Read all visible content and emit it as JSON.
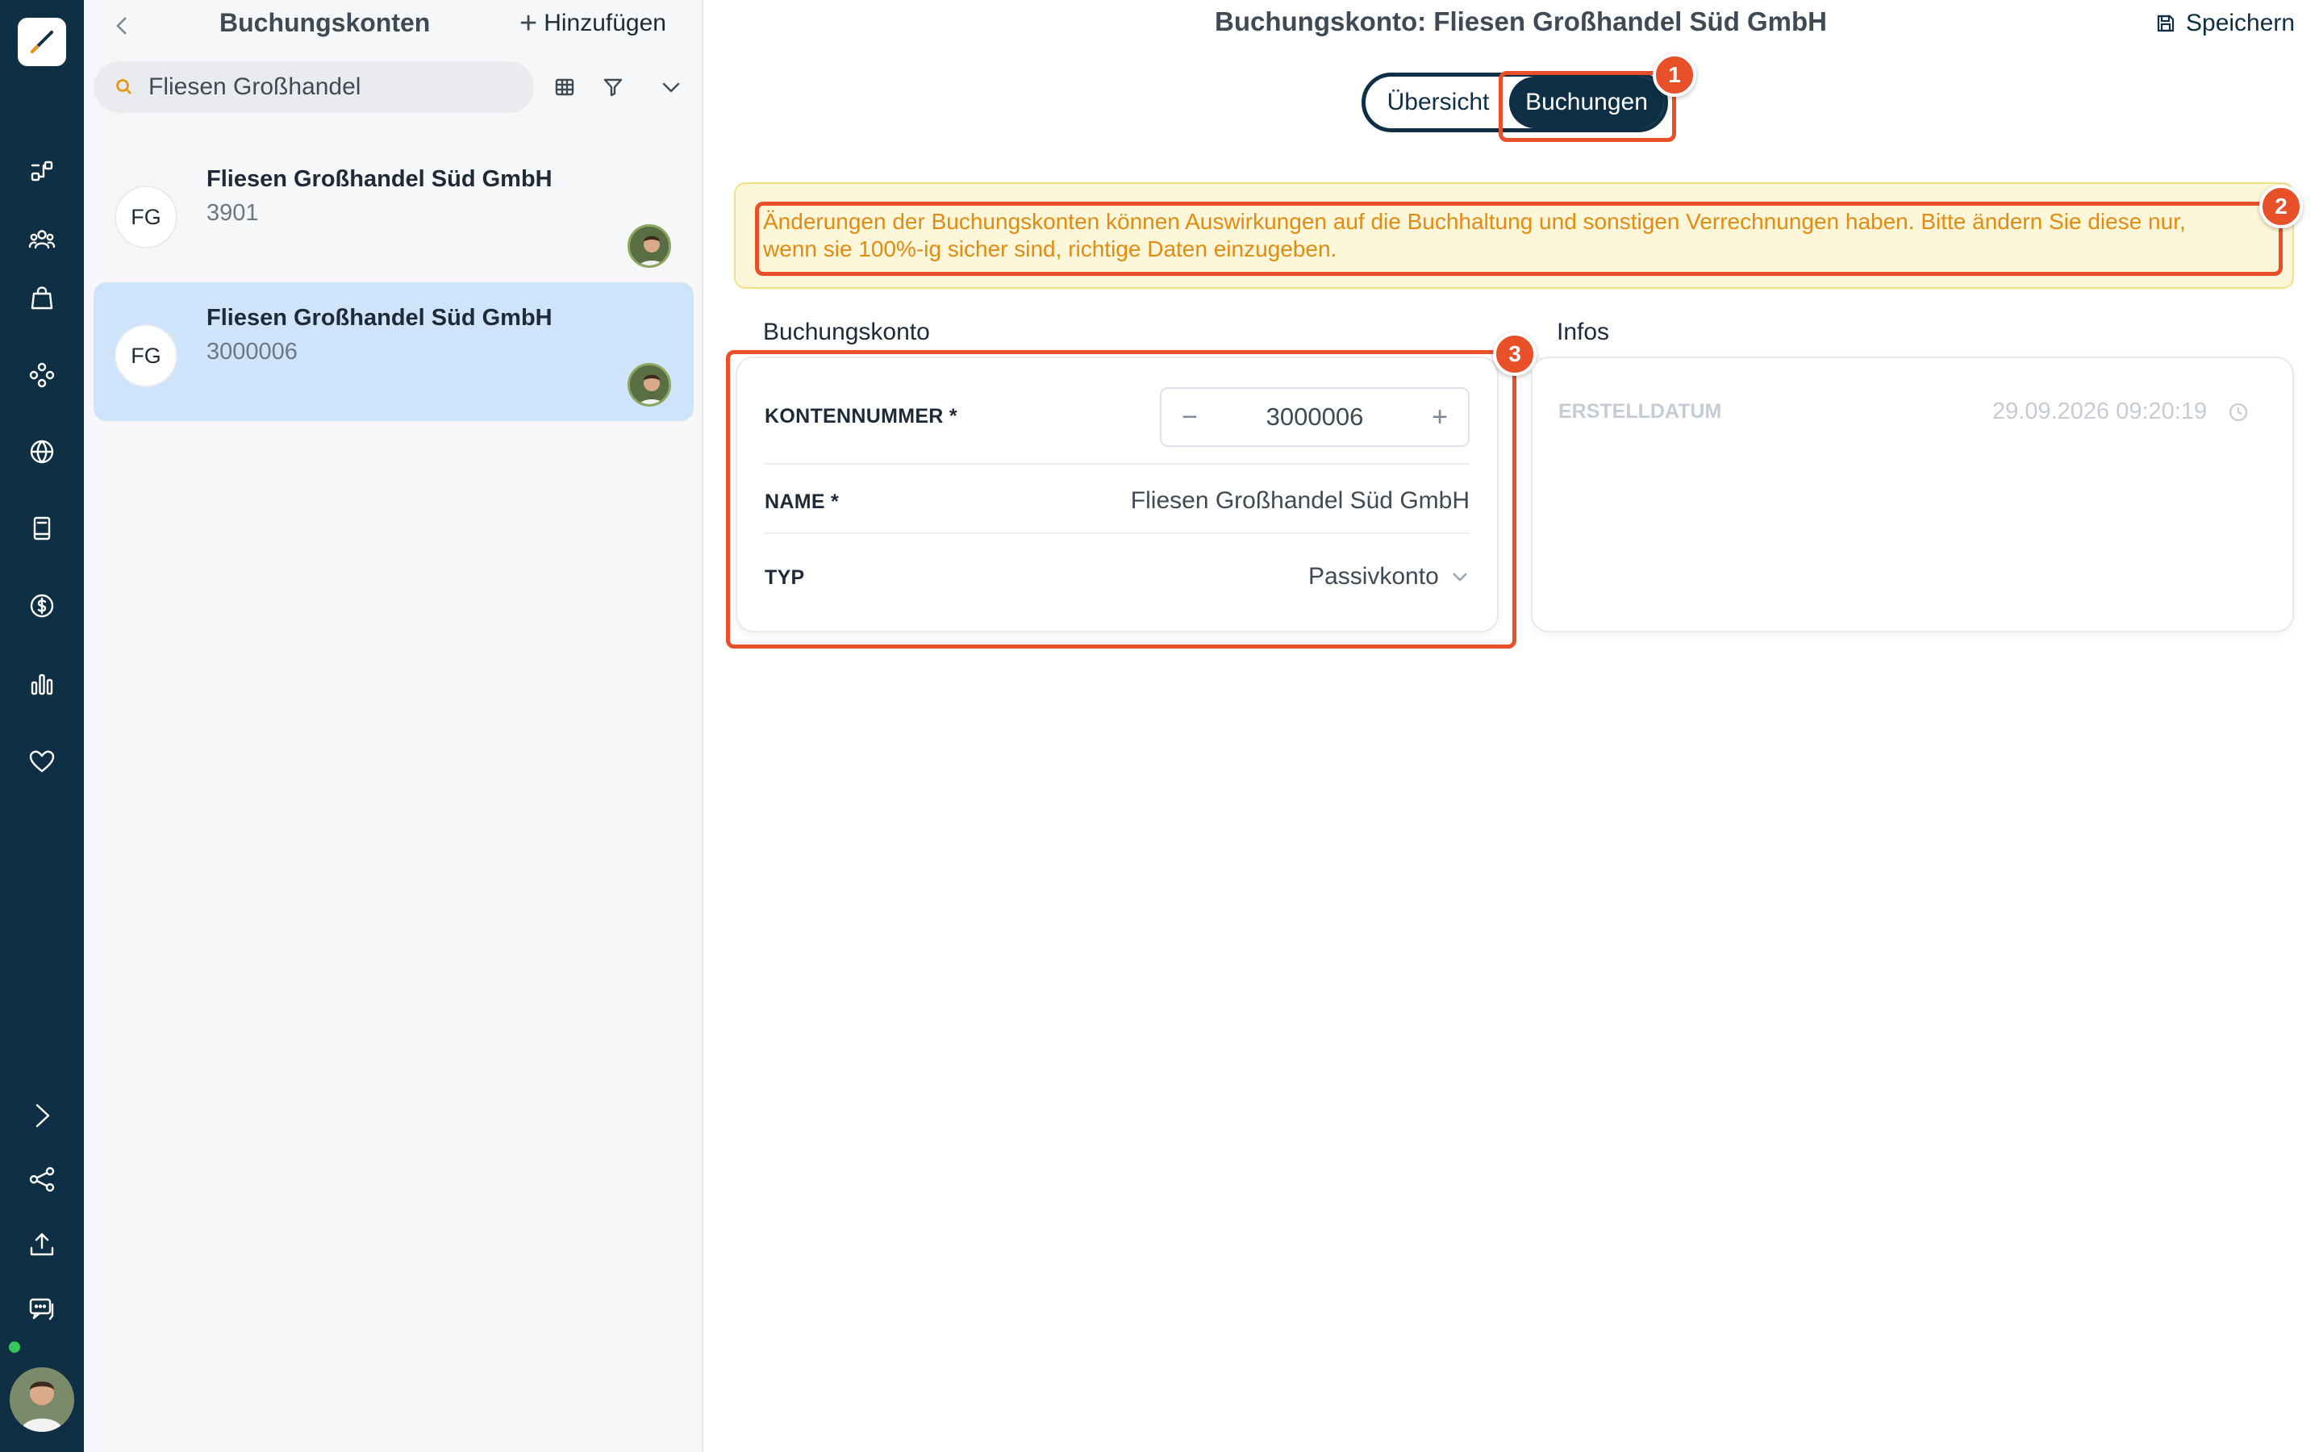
{
  "list_panel": {
    "title": "Buchungskonten",
    "add_label": "Hinzufügen",
    "search_value": "Fliesen Großhandel",
    "items": [
      {
        "initials": "FG",
        "name": "Fliesen Großhandel Süd GmbH",
        "number": "3901",
        "selected": false
      },
      {
        "initials": "FG",
        "name": "Fliesen Großhandel Süd GmbH",
        "number": "3000006",
        "selected": true
      }
    ]
  },
  "main": {
    "title": "Buchungskonto: Fliesen Großhandel Süd GmbH",
    "save_label": "Speichern",
    "tabs": [
      {
        "label": "Übersicht",
        "active": false
      },
      {
        "label": "Buchungen",
        "active": true
      }
    ],
    "warning": "Änderungen der Buchungskonten können Auswirkungen auf die Buchhaltung und sonstigen Verrechnungen haben. Bitte ändern Sie diese nur, wenn sie 100%-ig sicher sind, richtige Daten einzugeben.",
    "account_section": {
      "title": "Buchungskonto",
      "fields": {
        "number_label": "KONTENNUMMER *",
        "number_value": "3000006",
        "name_label": "NAME *",
        "name_value": "Fliesen Großhandel Süd GmbH",
        "type_label": "TYP",
        "type_value": "Passivkonto"
      }
    },
    "info_section": {
      "title": "Infos",
      "created_label": "ERSTELLDATUM",
      "created_value": "29.09.2026 09:20:19"
    }
  },
  "annotations": [
    "1",
    "2",
    "3"
  ],
  "colors": {
    "rail": "#0f2f44",
    "accent": "#0f2f44",
    "highlight": "#e8502a",
    "warning_text": "#e28b12",
    "warning_bg": "#fdf6d8",
    "selected_item": "#cfe4fb"
  }
}
